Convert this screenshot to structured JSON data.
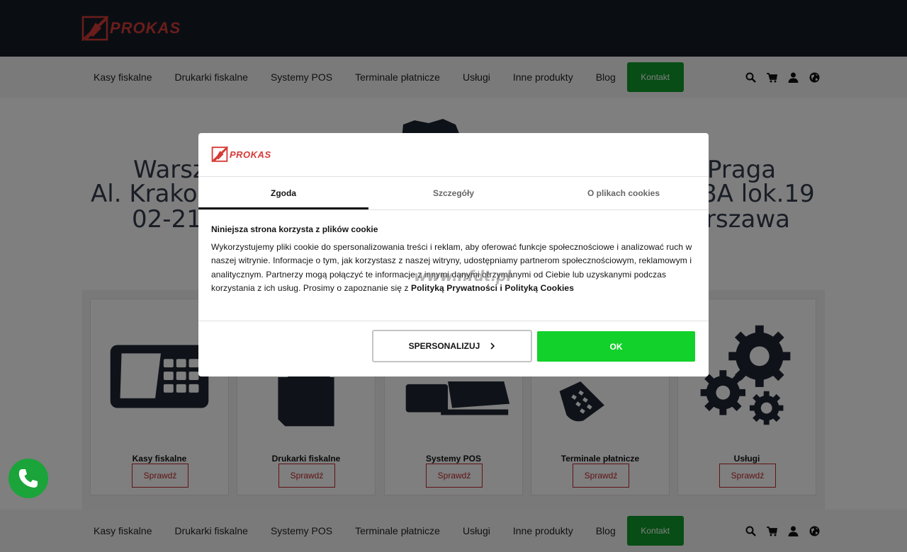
{
  "header": {
    "logo_text": "PROKAS",
    "brand_color": "#d63a36"
  },
  "nav": {
    "items": [
      {
        "label": "Kasy fiskalne"
      },
      {
        "label": "Drukarki fiskalne"
      },
      {
        "label": "Systemy POS"
      },
      {
        "label": "Terminale płatnicze"
      },
      {
        "label": "Usługi"
      },
      {
        "label": "Inne produkty"
      },
      {
        "label": "Blog"
      }
    ],
    "contact_label": "Kontakt",
    "contact_color": "#0f9a2a",
    "icons": [
      "search-icon",
      "cart-icon",
      "user-icon",
      "globe-icon"
    ]
  },
  "hero": {
    "left_lines": [
      "Warsz",
      "Al. Krakov",
      "02-21"
    ],
    "right_lines": [
      "Praga",
      "8A lok.19",
      "rszawa"
    ]
  },
  "products": [
    {
      "title": "Kasy fiskalne",
      "button": "Sprawdź",
      "icon": "cash-register-icon"
    },
    {
      "title": "Drukarki fiskalne",
      "button": "Sprawdź",
      "icon": "printer-icon"
    },
    {
      "title": "Systemy POS",
      "button": "Sprawdź",
      "icon": "pos-system-icon"
    },
    {
      "title": "Terminale płatnicze",
      "button": "Sprawdź",
      "icon": "payment-terminal-icon"
    },
    {
      "title": "Usługi",
      "button": "Sprawdź",
      "icon": "gears-icon"
    }
  ],
  "cookie_dialog": {
    "logo_text": "PROKAS",
    "tabs": [
      {
        "label": "Zgoda",
        "active": true
      },
      {
        "label": "Szczegóły",
        "active": false
      },
      {
        "label": "O plikach cookies",
        "active": false
      }
    ],
    "heading": "Niniejsza strona korzysta z plików cookie",
    "body": "Wykorzystujemy pliki cookie do spersonalizowania treści i reklam, aby oferować funkcje społecznościowe i analizować ruch w naszej witrynie. Informacje o tym, jak korzystasz z naszej witryny, udostępniamy partnerom społecznościowym, reklamowym i analitycznym. Partnerzy mogą połączyć te informacje z innymi danymi otrzymanymi od Ciebie lub uzyskanymi podczas korzystania z ich usług. Prosimy o zapoznanie się z",
    "link_text": "Polityką Prywatności i Polityką Cookies",
    "watermark": "www.nfdt.pl",
    "personalize_label": "SPERSONALIZUJ",
    "ok_label": "OK",
    "ok_color": "#12d12a"
  }
}
